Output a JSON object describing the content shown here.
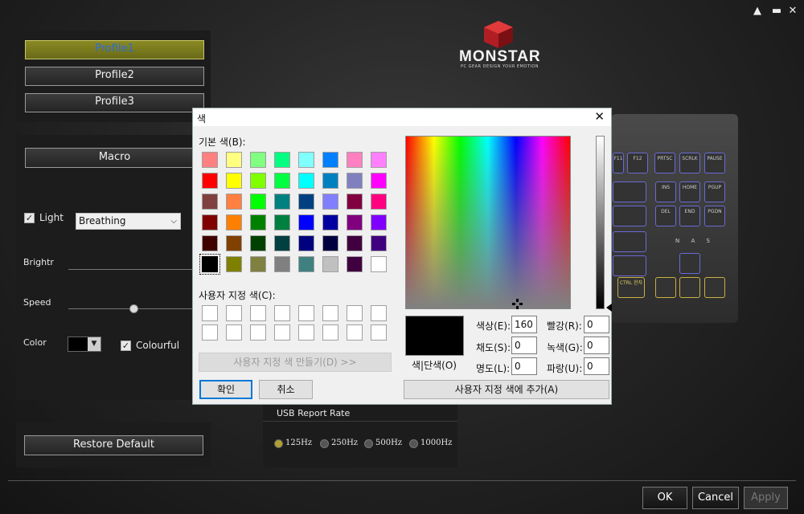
{
  "window": {
    "controls": [
      "▲",
      "▬",
      "✕"
    ]
  },
  "logo": {
    "brand": "MONSTAR",
    "tagline": "PC GEAR DESIGN YOUR EMOTION"
  },
  "profiles": [
    "Profile1",
    "Profile2",
    "Profile3"
  ],
  "macro": "Macro",
  "lighting": {
    "light_label": "Light",
    "light_checked": true,
    "mode": "Breathing",
    "brightness_label": "Brightr",
    "speed_label": "Speed",
    "color_label": "Color",
    "color_value": "#000000",
    "colourful_label": "Colourful",
    "colourful_checked": true
  },
  "restore": "Restore Default",
  "usb": {
    "title": "USB Report Rate",
    "options": [
      "125Hz",
      "250Hz",
      "500Hz",
      "1000Hz"
    ],
    "selected": "125Hz"
  },
  "bottom": {
    "ok": "OK",
    "cancel": "Cancel",
    "apply": "Apply"
  },
  "keyboard_keys": [
    "F11",
    "F12",
    "PRTSC",
    "SCRLK",
    "PAUSE",
    "INS",
    "HOME",
    "PGUP",
    "DEL",
    "END",
    "PGDN",
    "CTRL 한자"
  ],
  "keyboard_indicators": "N A S",
  "color_dialog": {
    "title": "색",
    "basic_label": "기본 색(B):",
    "basic_colors": [
      "#FF8080",
      "#FFFF80",
      "#80FF80",
      "#00FF80",
      "#80FFFF",
      "#0080FF",
      "#FF80C0",
      "#FF80FF",
      "#FF0000",
      "#FFFF00",
      "#80FF00",
      "#00FF40",
      "#00FFFF",
      "#0080C0",
      "#8080C0",
      "#FF00FF",
      "#804040",
      "#FF8040",
      "#00FF00",
      "#008080",
      "#004080",
      "#8080FF",
      "#800040",
      "#FF0080",
      "#800000",
      "#FF8000",
      "#008000",
      "#008040",
      "#0000FF",
      "#0000A0",
      "#800080",
      "#8000FF",
      "#400000",
      "#804000",
      "#004000",
      "#004040",
      "#000080",
      "#000040",
      "#400040",
      "#400080",
      "#000000",
      "#808000",
      "#808040",
      "#808080",
      "#408080",
      "#C0C0C0",
      "#400040",
      "#FFFFFF"
    ],
    "selected_basic_index": 40,
    "custom_label": "사용자 지정 색(C):",
    "custom_colors": [
      "#FFFFFF",
      "#FFFFFF",
      "#FFFFFF",
      "#FFFFFF",
      "#FFFFFF",
      "#FFFFFF",
      "#FFFFFF",
      "#FFFFFF",
      "#FFFFFF",
      "#FFFFFF",
      "#FFFFFF",
      "#FFFFFF",
      "#FFFFFF",
      "#FFFFFF",
      "#FFFFFF",
      "#FFFFFF"
    ],
    "define_custom": "사용자 지정 색 만들기(D) >>",
    "ok": "확인",
    "cancel": "취소",
    "solid_label": "색|단색(O)",
    "hue_label": "색상(E):",
    "hue": "160",
    "sat_label": "채도(S):",
    "sat": "0",
    "lum_label": "명도(L):",
    "lum": "0",
    "red_label": "빨강(R):",
    "red": "0",
    "green_label": "녹색(G):",
    "green": "0",
    "blue_label": "파랑(U):",
    "blue": "0",
    "add_custom": "사용자 지정 색에 추가(A)",
    "preview_color": "#000000"
  }
}
